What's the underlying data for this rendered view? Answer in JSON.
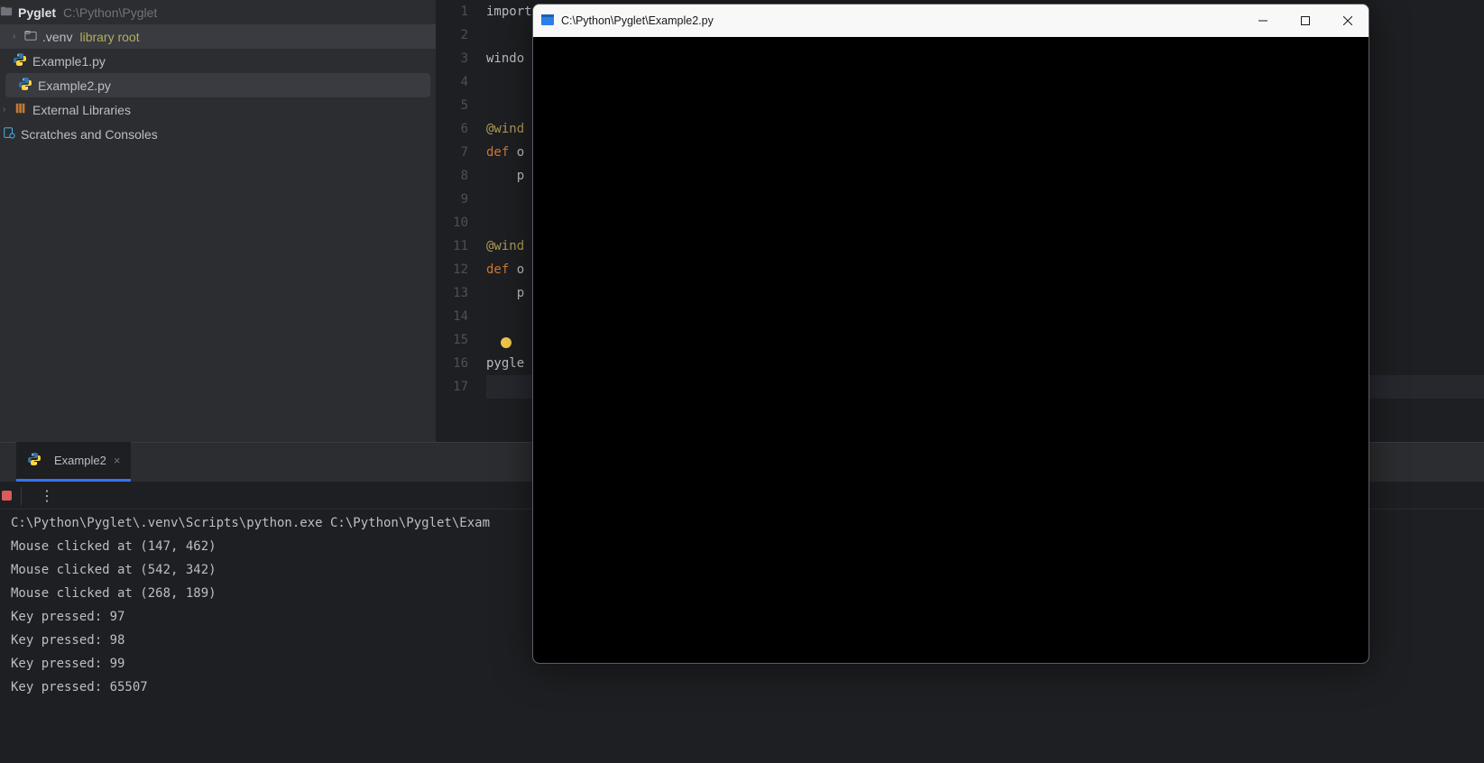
{
  "sidebar": {
    "project_name": "Pyglet",
    "project_path": "C:\\Python\\Pyglet",
    "venv_name": ".venv",
    "venv_label": "library root",
    "files": [
      {
        "name": "Example1.py"
      },
      {
        "name": "Example2.py"
      }
    ],
    "external_libs": "External Libraries",
    "scratches": "Scratches and Consoles"
  },
  "editor": {
    "gutter_start": 1,
    "gutter_end": 17,
    "lines": {
      "l1": "import pyglet",
      "l3": "windo",
      "l6": "@wind",
      "l7_def": "def ",
      "l7_rest": "o",
      "l8": "    p",
      "l11": "@wind",
      "l12_def": "def ",
      "l12_rest": "o",
      "l13": "    p",
      "l16": "pygle"
    }
  },
  "run": {
    "tab_name": "Example2",
    "cmd": "C:\\Python\\Pyglet\\.venv\\Scripts\\python.exe C:\\Python\\Pyglet\\Exam",
    "outputs": [
      "Mouse clicked at (147, 462)",
      "Mouse clicked at (542, 342)",
      "Mouse clicked at (268, 189)",
      "Key pressed: 97",
      "Key pressed: 98",
      "Key pressed: 99",
      "Key pressed: 65507"
    ]
  },
  "pyglet_window": {
    "title": "C:\\Python\\Pyglet\\Example2.py"
  }
}
